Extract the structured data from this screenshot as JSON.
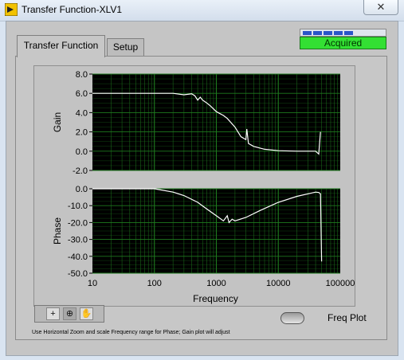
{
  "window": {
    "title": "Transfer Function-XLV1",
    "close_label": "✕"
  },
  "tabs": [
    {
      "label": "Transfer Function",
      "active": true
    },
    {
      "label": "Setup",
      "active": false
    }
  ],
  "status": {
    "label": "Acquired",
    "color": "#33e033",
    "progress_segments": 5
  },
  "toolbar": {
    "tools": [
      {
        "icon": "crosshair-icon",
        "glyph": "+"
      },
      {
        "icon": "zoom-icon",
        "glyph": "⊕"
      },
      {
        "icon": "hand-icon",
        "glyph": "✋"
      }
    ]
  },
  "freq_plot": {
    "label": "Freq Plot",
    "on": false
  },
  "hint": "Use Horizontal Zoom and scale Frequency range for Phase; Gain plot will adjust",
  "colors": {
    "plot_bg": "#000000",
    "grid": "#1e7a1e",
    "trace": "#ffffff"
  },
  "chart_data": [
    {
      "type": "line",
      "title": "",
      "xlabel": "",
      "ylabel": "Gain",
      "x_scale": "log",
      "xlim": [
        10,
        100000
      ],
      "ylim": [
        -2.0,
        8.0
      ],
      "yticks": [
        "8.0",
        "6.0",
        "4.0",
        "2.0",
        "0.0",
        "-2.0"
      ],
      "grid": true,
      "series": [
        {
          "x": [
            10,
            30,
            100,
            200,
            300,
            400,
            450,
            500,
            550,
            600,
            700,
            800,
            1000,
            1300,
            1500,
            2000,
            2500,
            3000,
            3100,
            3300,
            4000,
            6000,
            10000,
            20000,
            40000,
            45000,
            48000
          ],
          "y": [
            6.0,
            6.0,
            6.0,
            6.0,
            5.85,
            5.95,
            5.75,
            5.3,
            5.6,
            5.3,
            5.0,
            4.7,
            4.1,
            3.7,
            3.4,
            2.5,
            1.5,
            1.2,
            2.3,
            0.8,
            0.5,
            0.2,
            0.05,
            0.0,
            0.0,
            -0.3,
            2.0
          ]
        }
      ]
    },
    {
      "type": "line",
      "title": "",
      "xlabel": "Frequency",
      "ylabel": "Phase",
      "x_scale": "log",
      "xlim": [
        10,
        100000
      ],
      "ylim": [
        -50.0,
        0.0
      ],
      "yticks": [
        "0.0",
        "-10.0",
        "-20.0",
        "-30.0",
        "-40.0",
        "-50.0"
      ],
      "xticks": [
        "10",
        "100",
        "1000",
        "10000",
        "100000"
      ],
      "grid": true,
      "series": [
        {
          "x": [
            10,
            50,
            100,
            200,
            300,
            500,
            700,
            1000,
            1300,
            1500,
            1600,
            1800,
            2000,
            3000,
            5000,
            10000,
            20000,
            30000,
            40000,
            45000,
            48000,
            50000
          ],
          "y": [
            0,
            0,
            0,
            -2,
            -4,
            -8,
            -12,
            -16,
            -19,
            -16,
            -20,
            -18,
            -19,
            -17,
            -13,
            -8,
            -4.5,
            -3,
            -2,
            -2.2,
            -3,
            -43
          ]
        }
      ]
    }
  ]
}
